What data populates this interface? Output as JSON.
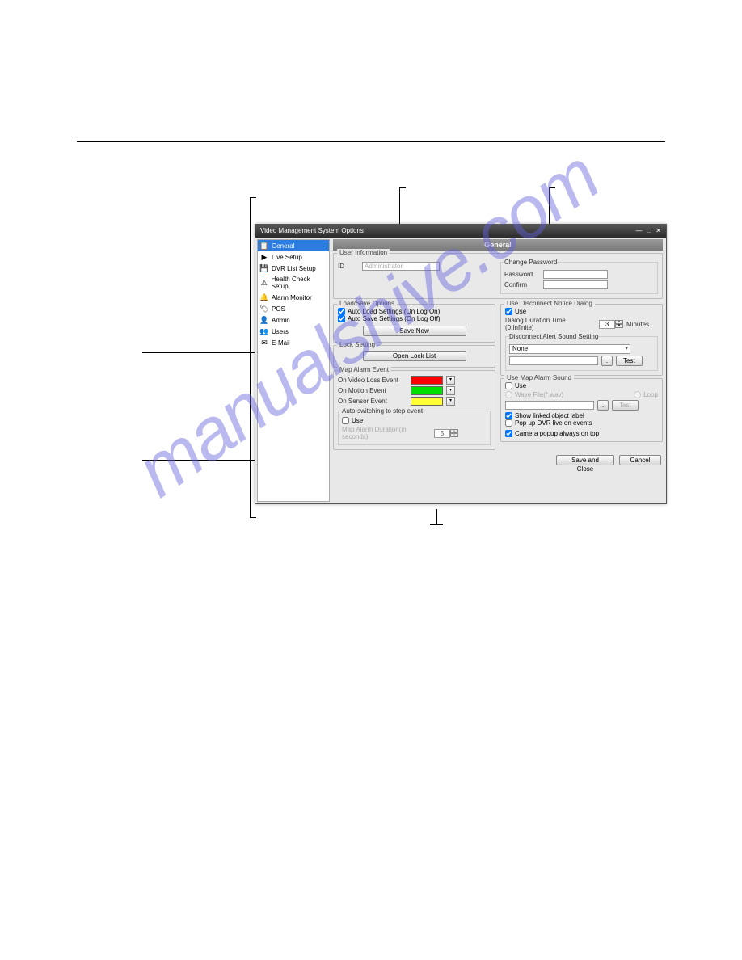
{
  "window": {
    "title": "Video Management System Options"
  },
  "sidebar": {
    "items": [
      {
        "label": "General",
        "icon": "📋",
        "selected": true
      },
      {
        "label": "Live Setup",
        "icon": "▶",
        "selected": false
      },
      {
        "label": "DVR List Setup",
        "icon": "💾",
        "selected": false
      },
      {
        "label": "Health Check Setup",
        "icon": "⚠",
        "selected": false
      },
      {
        "label": "Alarm Monitor",
        "icon": "🔔",
        "selected": false
      },
      {
        "label": "POS",
        "icon": "🏷",
        "selected": false
      },
      {
        "label": "Admin",
        "icon": "👤",
        "selected": false
      },
      {
        "label": "Users",
        "icon": "👥",
        "selected": false
      },
      {
        "label": "E-Mail",
        "icon": "✉",
        "selected": false
      }
    ]
  },
  "main": {
    "header": "General"
  },
  "user_info": {
    "group": "User Information",
    "id_label": "ID",
    "id_value": "Administrator",
    "change_pw_group": "Change Password",
    "password_label": "Password",
    "confirm_label": "Confirm"
  },
  "load_save": {
    "group": "Load/Save Options",
    "auto_load_label": "Auto Load Settings (On Log On)",
    "auto_load_checked": true,
    "auto_save_label": "Auto Save Settings (On Log Off)",
    "auto_save_checked": true,
    "save_now_btn": "Save Now"
  },
  "disconnect": {
    "group": "Use Disconnect Notice Dialog",
    "use_label": "Use",
    "use_checked": true,
    "duration_label": "Dialog Duration Time (0:Infinite)",
    "duration_value": "3",
    "duration_unit": "Minutes.",
    "sound_group": "Disconnect Alert Sound Setting",
    "sound_value": "None",
    "test_btn": "Test"
  },
  "lock": {
    "group": "Lock Setting",
    "open_btn": "Open Lock List"
  },
  "map_alarm": {
    "group": "Map Alarm Event",
    "video_loss_label": "On Video Loss Event",
    "video_loss_color": "#ff0000",
    "motion_label": "On Motion Event",
    "motion_color": "#00e000",
    "sensor_label": "On Sensor Event",
    "sensor_color": "#ffff33",
    "auto_switch_group": "Auto-switching to step event",
    "auto_use_label": "Use",
    "auto_use_checked": false,
    "auto_duration_label": "Map Alarm Duration(in seconds)",
    "auto_duration_value": "5"
  },
  "map_sound": {
    "group": "Use Map Alarm Sound",
    "use_label": "Use",
    "use_checked": false,
    "wave_label": "Wave File(*.wav)",
    "loop_label": "Loop",
    "test_btn": "Test",
    "show_label_label": "Show linked object label",
    "show_label_checked": true,
    "popup_dvr_label": "Pop up DVR live on events",
    "popup_dvr_checked": false,
    "camera_top_label": "Camera popup always on top",
    "camera_top_checked": true
  },
  "footer": {
    "save_close": "Save and Close",
    "cancel": "Cancel"
  }
}
